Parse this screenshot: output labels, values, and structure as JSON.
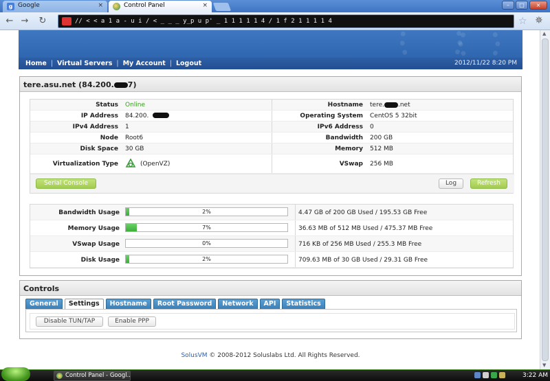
{
  "browser": {
    "tabs": [
      {
        "label": "Google",
        "close": "×"
      },
      {
        "label": "Control Panel",
        "close": "×"
      }
    ],
    "nav": {
      "back": "←",
      "forward": "→",
      "reload": "↻"
    },
    "address": "// < < a 1 a - u i / < _ _ _ y_p u p' _ 1 1 1 1 1 4 / 1 f 2 1 1 1 1 4",
    "star": "☆",
    "wrench": "✵",
    "window_buttons": [
      "–",
      "□",
      "×"
    ]
  },
  "site": {
    "nav_links": [
      "Home",
      "Virtual Servers",
      "My Account",
      "Logout"
    ],
    "nav_sep": "|",
    "datetime": "2012/11/22 8:20 PM"
  },
  "server": {
    "title_prefix": "tere.asu.net (84.200.",
    "title_suffix": "7)",
    "info_rows": [
      {
        "l": "Status",
        "v": "Online",
        "l2": "Hostname",
        "v2_prefix": "tere.",
        "v2_suffix": ".net"
      },
      {
        "l": "IP Address",
        "v": "84.200.",
        "l2": "Operating System",
        "v2": "CentOS 5 32bit"
      },
      {
        "l": "IPv4 Address",
        "v": "1",
        "l2": "IPv6 Address",
        "v2": "0"
      },
      {
        "l": "Node",
        "v": "Root6",
        "l2": "Bandwidth",
        "v2": "200 GB"
      },
      {
        "l": "Disk Space",
        "v": "30 GB",
        "l2": "Memory",
        "v2": "512 MB"
      },
      {
        "l": "Virtualization Type",
        "v": "(OpenVZ)",
        "l2": "VSwap",
        "v2": "256 MB"
      }
    ],
    "buttons": {
      "serial_console": "Serial Console",
      "log": "Log",
      "refresh": "Refresh"
    },
    "usage": [
      {
        "label": "Bandwidth Usage",
        "percent": 2,
        "percent_text": "2%",
        "detail": "4.47 GB of 200 GB Used / 195.53 GB Free"
      },
      {
        "label": "Memory Usage",
        "percent": 7,
        "percent_text": "7%",
        "detail": "36.63 MB of 512 MB Used / 475.37 MB Free"
      },
      {
        "label": "VSwap Usage",
        "percent": 0,
        "percent_text": "0%",
        "detail": "716 KB of 256 MB Used / 255.3 MB Free"
      },
      {
        "label": "Disk Usage",
        "percent": 2,
        "percent_text": "2%",
        "detail": "709.63 MB of 30 GB Used / 29.31 GB Free"
      }
    ]
  },
  "controls": {
    "title": "Controls",
    "tabs": [
      "General",
      "Settings",
      "Hostname",
      "Root Password",
      "Network",
      "API",
      "Statistics"
    ],
    "active_tab": "Settings",
    "buttons": {
      "disable_tun": "Disable TUN/TAP",
      "enable_ppp": "Enable PPP"
    }
  },
  "footer": {
    "brand": "SolusVM",
    "text": " © 2008-2012 Soluslabs Ltd. All Rights Reserved."
  },
  "taskbar": {
    "item": "Control Panel - Googl...",
    "clock": "3:22 AM"
  },
  "colors": {
    "accent_blue": "#2e66b0",
    "online_green": "#3a9a23",
    "usage_green": "#3cae3a",
    "button_green": "#a3cc4c"
  }
}
